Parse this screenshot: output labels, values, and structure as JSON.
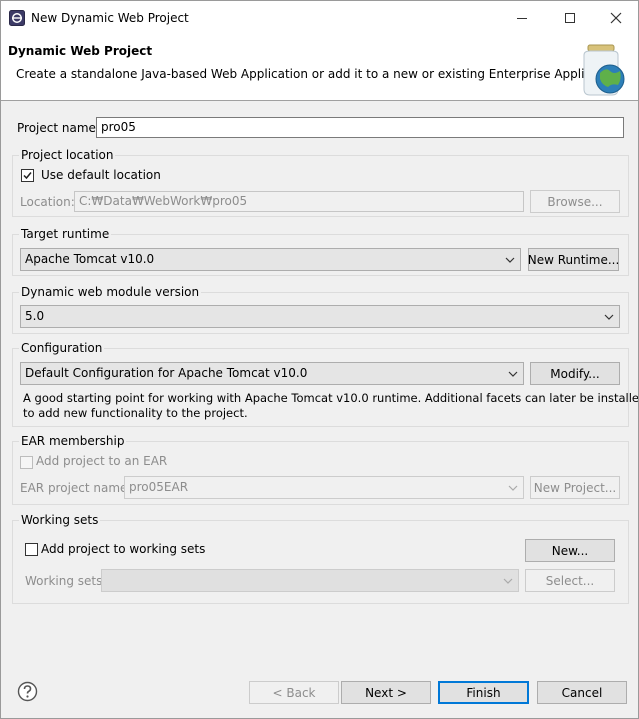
{
  "window": {
    "title": "New Dynamic Web Project",
    "icon": "eclipse-icon",
    "controls": [
      "minimize-icon",
      "maximize-icon",
      "close-icon"
    ]
  },
  "header": {
    "title": "Dynamic Web Project",
    "description": "Create a standalone Java-based Web Application or add it to a new or existing Enterprise Application.",
    "image": "web-project-jar-globe-icon"
  },
  "project_name": {
    "label": "Project name:",
    "value": "pro05"
  },
  "project_location": {
    "group_label": "Project location",
    "use_default_label": "Use default location",
    "use_default_checked": true,
    "location_label": "Location:",
    "location_value": "C:₩Data₩WebWork₩pro05",
    "browse_label": "Browse..."
  },
  "target_runtime": {
    "group_label": "Target runtime",
    "selected": "Apache Tomcat v10.0",
    "new_runtime_label": "New Runtime..."
  },
  "module_version": {
    "group_label": "Dynamic web module version",
    "selected": "5.0"
  },
  "configuration": {
    "group_label": "Configuration",
    "selected": "Default Configuration for Apache Tomcat v10.0",
    "modify_label": "Modify...",
    "description_line1": "A good starting point for working with Apache Tomcat v10.0 runtime. Additional facets can later be installed",
    "description_line2": "to add new functionality to the project."
  },
  "ear_membership": {
    "group_label": "EAR membership",
    "add_label": "Add project to an EAR",
    "add_checked": false,
    "ear_name_label": "EAR project name:",
    "ear_name_value": "pro05EAR",
    "new_project_label": "New Project..."
  },
  "working_sets": {
    "group_label": "Working sets",
    "add_label": "Add project to working sets",
    "add_checked": false,
    "new_label": "New...",
    "sets_label": "Working sets:",
    "sets_value": "",
    "select_label": "Select..."
  },
  "footer": {
    "help_icon": "help-icon",
    "back_label": "< Back",
    "next_label": "Next >",
    "finish_label": "Finish",
    "cancel_label": "Cancel"
  },
  "colors": {
    "accent": "#0078d7",
    "window_bg": "#f0f0f0",
    "disabled_text": "#8d8d8d"
  }
}
